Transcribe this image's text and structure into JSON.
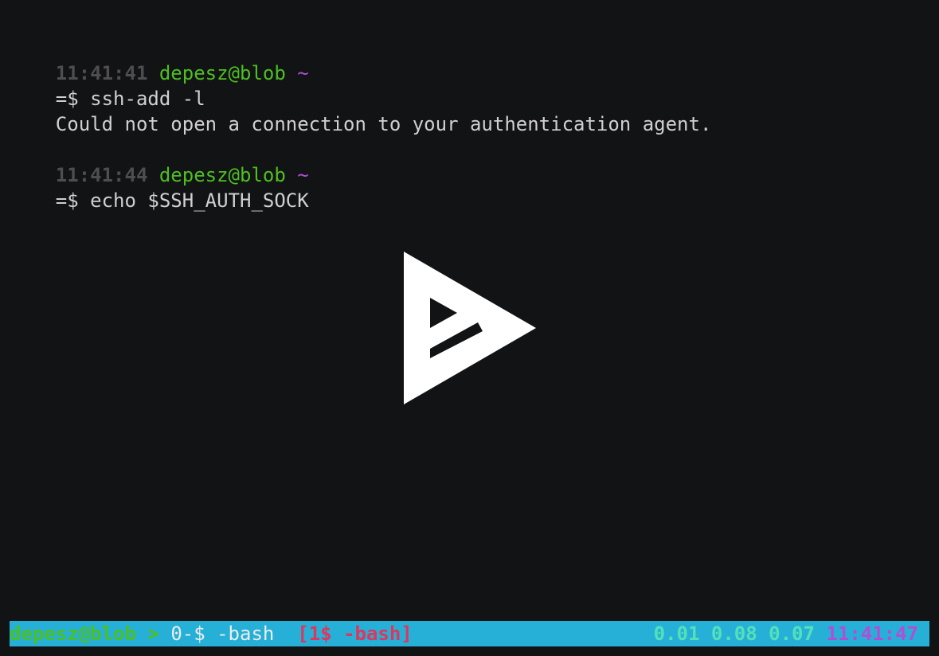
{
  "lines": [
    {
      "time": "11:41:41",
      "user": "depesz@blob",
      "dir": "~"
    },
    {
      "prompt": "=$",
      "command": "ssh-add -l"
    },
    {
      "output": "Could not open a connection to your authentication agent."
    },
    {
      "time": "11:41:44",
      "user": "depesz@blob",
      "dir": "~"
    },
    {
      "prompt": "=$",
      "command": "echo $SSH_AUTH_SOCK"
    }
  ],
  "status_bar": {
    "session_user": "depesz@blob",
    "separator": ">",
    "window_0": "0-$ -bash",
    "window_1_active": "[1$ -bash]",
    "load_1": "0.01",
    "load_5": "0.08",
    "load_15": "0.07",
    "clock": "11:41:47"
  },
  "player": {
    "play_icon": "asciinema-play-icon"
  },
  "colors": {
    "background": "#121314",
    "status_bar": "#26b0d7",
    "user": "#4ebf22",
    "tilde": "#b04fd6",
    "active_window": "#e0365c",
    "load": "#54e1b9"
  }
}
